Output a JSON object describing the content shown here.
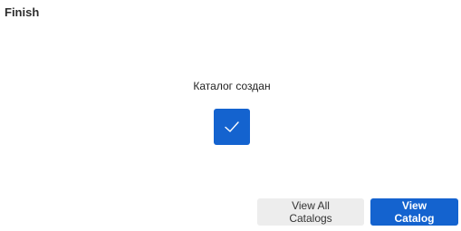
{
  "header": {
    "title": "Finish"
  },
  "status": {
    "message": "Каталог создан",
    "icon": "checkmark-icon",
    "accent_color": "#1463cf"
  },
  "actions": {
    "view_all_label": "View All Catalogs",
    "view_catalog_label": "View Catalog"
  }
}
